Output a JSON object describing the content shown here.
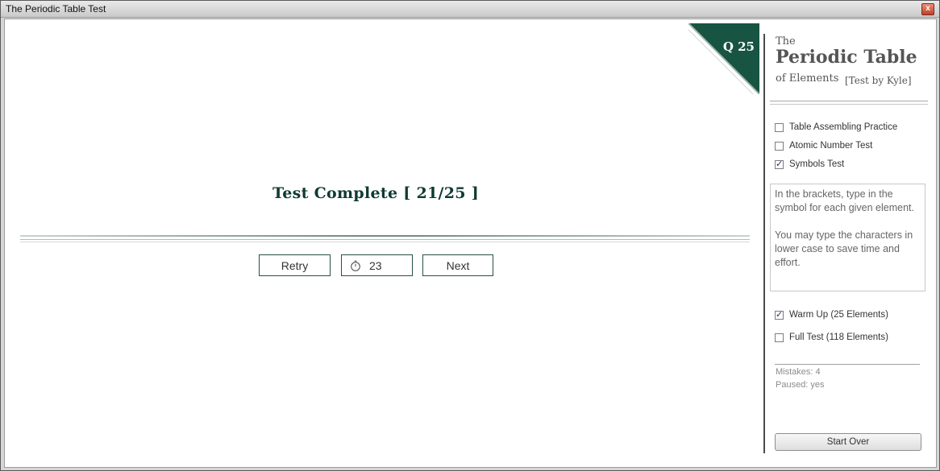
{
  "window": {
    "title": "The Periodic Table Test",
    "close_glyph": "x"
  },
  "badge": {
    "label": "Q 25",
    "color": "#175441"
  },
  "result": {
    "label": "Test Complete  [ 21/25 ]"
  },
  "buttons": {
    "retry": "Retry",
    "timer_value": "23",
    "next": "Next"
  },
  "brand": {
    "the": "The",
    "main": "Periodic Table",
    "sub": "of Elements",
    "by": "[Test by Kyle]"
  },
  "modes": [
    {
      "label": "Table Assembling Practice",
      "checked": false
    },
    {
      "label": "Atomic Number Test",
      "checked": false
    },
    {
      "label": "Symbols Test",
      "checked": true
    }
  ],
  "instructions": {
    "para1": "In the brackets, type in the symbol for each given element.",
    "para2": "You may type the characters in lower case to save time and effort."
  },
  "sets": [
    {
      "label": "Warm Up (25 Elements)",
      "checked": true
    },
    {
      "label": "Full Test (118 Elements)",
      "checked": false
    }
  ],
  "stats": {
    "mistakes": "Mistakes: 4",
    "paused": "Paused: yes"
  },
  "start_over": "Start Over"
}
